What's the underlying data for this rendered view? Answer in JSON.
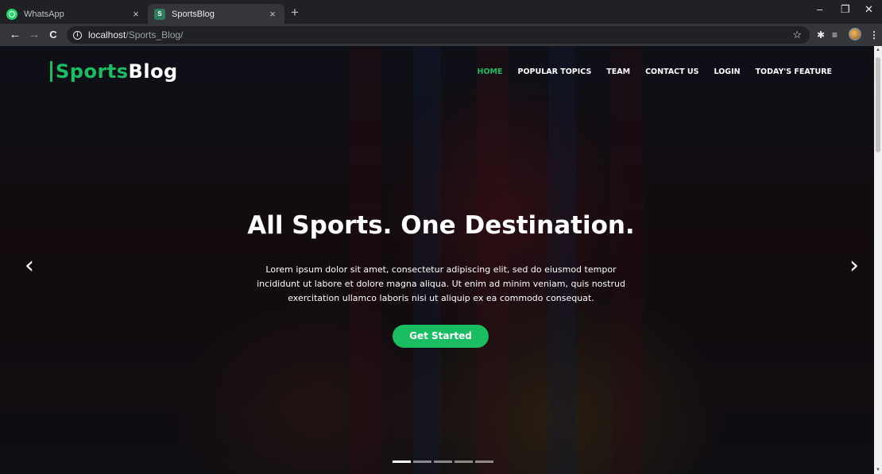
{
  "browser": {
    "tabs": [
      {
        "title": "WhatsApp",
        "close": "×"
      },
      {
        "title": "SportsBlog",
        "close": "×"
      }
    ],
    "new_tab": "+",
    "window_controls": {
      "minimize": "–",
      "maximize": "❐",
      "close": "✕"
    },
    "nav": {
      "back": "←",
      "forward": "→",
      "reload": "C"
    },
    "url": {
      "host": "localhost",
      "path": "/Sports_Blog/"
    },
    "bookmark_star": "☆",
    "extension_icons": [
      "puzzle-icon",
      "reading-list-icon"
    ],
    "menu": "⋮"
  },
  "site": {
    "logo": {
      "part1": "Sports",
      "part2": "Blog"
    },
    "nav": [
      "HOME",
      "POPULAR TOPICS",
      "TEAM",
      "CONTACT US",
      "LOGIN",
      "TODAY'S FEATURE"
    ],
    "active_nav": "HOME",
    "accent_color": "#1bbd62"
  },
  "hero": {
    "title": "All Sports. One Destination.",
    "text": "Lorem ipsum dolor sit amet, consectetur adipiscing elit, sed do eiusmod tempor incididunt ut labore et dolore magna aliqua. Ut enim ad minim veniam, quis nostrud exercitation ullamco laboris nisi ut aliquip ex ea commodo consequat.",
    "cta": "Get Started",
    "prev_arrow": "‹",
    "next_arrow": "›",
    "slides_count": 5,
    "active_slide": 1
  }
}
